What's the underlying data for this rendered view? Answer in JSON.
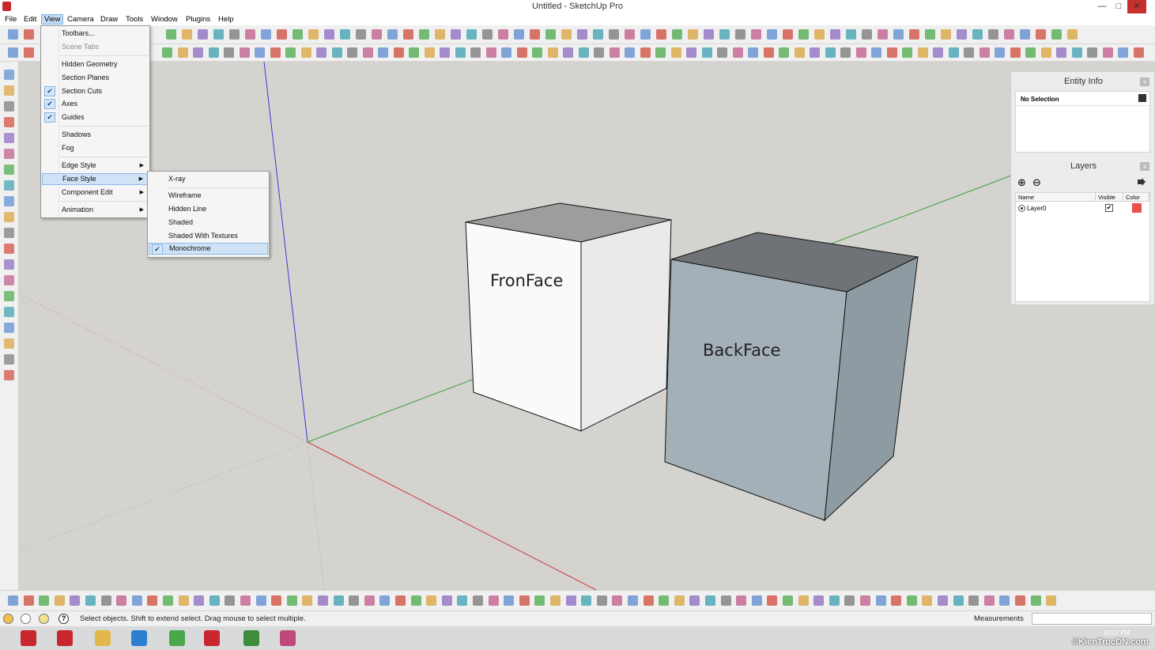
{
  "window": {
    "title": "Untitled - SketchUp Pro",
    "minimize_glyph": "—",
    "maximize_glyph": "□",
    "close_glyph": "✕"
  },
  "menubar": {
    "items": [
      "File",
      "Edit",
      "View",
      "Camera",
      "Draw",
      "Tools",
      "Window",
      "Plugins",
      "Help"
    ],
    "active": "View"
  },
  "view_menu": {
    "items": [
      {
        "label": "Toolbars...",
        "checked": false,
        "disabled": false,
        "submenu": false
      },
      {
        "label": "Scene Tabs",
        "checked": false,
        "disabled": true,
        "submenu": false
      },
      {
        "label": "Hidden Geometry",
        "checked": false,
        "disabled": false,
        "submenu": false
      },
      {
        "label": "Section Planes",
        "checked": false,
        "disabled": false,
        "submenu": false
      },
      {
        "label": "Section Cuts",
        "checked": true,
        "disabled": false,
        "submenu": false
      },
      {
        "label": "Axes",
        "checked": true,
        "disabled": false,
        "submenu": false
      },
      {
        "label": "Guides",
        "checked": true,
        "disabled": false,
        "submenu": false
      },
      {
        "label": "Shadows",
        "checked": false,
        "disabled": false,
        "submenu": false
      },
      {
        "label": "Fog",
        "checked": false,
        "disabled": false,
        "submenu": false
      },
      {
        "label": "Edge Style",
        "checked": false,
        "disabled": false,
        "submenu": true
      },
      {
        "label": "Face Style",
        "checked": false,
        "disabled": false,
        "submenu": true,
        "highlight": true
      },
      {
        "label": "Component Edit",
        "checked": false,
        "disabled": false,
        "submenu": true
      },
      {
        "label": "Animation",
        "checked": false,
        "disabled": false,
        "submenu": true
      }
    ],
    "check_glyph": "✔",
    "arrow_glyph": "▶"
  },
  "face_style_menu": {
    "items": [
      {
        "label": "X-ray",
        "checked": false
      },
      {
        "label": "Wireframe",
        "checked": false
      },
      {
        "label": "Hidden Line",
        "checked": false
      },
      {
        "label": "Shaded",
        "checked": false
      },
      {
        "label": "Shaded With Textures",
        "checked": false
      },
      {
        "label": "Monochrome",
        "checked": true
      }
    ]
  },
  "viewport": {
    "front_label": "FronFace",
    "back_label": "BackFace",
    "colors": {
      "background": "#d4d3cf",
      "front_face": "#fafafa",
      "back_face": "#a3b0b7",
      "axis_red": "#d03a3a",
      "axis_green": "#3aa03a",
      "axis_blue": "#3a3ad0"
    }
  },
  "entity_info": {
    "title": "Entity Info",
    "selection": "No Selection",
    "close_glyph": "x"
  },
  "layers": {
    "title": "Layers",
    "close_glyph": "x",
    "add_glyph": "⊕",
    "remove_glyph": "⊖",
    "columns": [
      "Name",
      "Visible",
      "Color"
    ],
    "rows": [
      {
        "name": "Layer0",
        "visible": true,
        "color": "#e8514f",
        "active": true
      }
    ],
    "visible_glyph": "✔"
  },
  "statusbar": {
    "hint": "Select objects. Shift to extend select. Drag mouse to select multiple.",
    "measurements_label": "Measurements",
    "measurements_value": ""
  },
  "taskbar": {
    "clock": "10:07 PM",
    "watermark": "©KienTrucDN.com",
    "apps": [
      "sketchup-layout-icon",
      "style-builder-icon",
      "file-explorer-icon",
      "remote-desktop-icon",
      "photo-app-icon",
      "sketchup-icon",
      "chrome-icon",
      "paint-icon"
    ]
  }
}
